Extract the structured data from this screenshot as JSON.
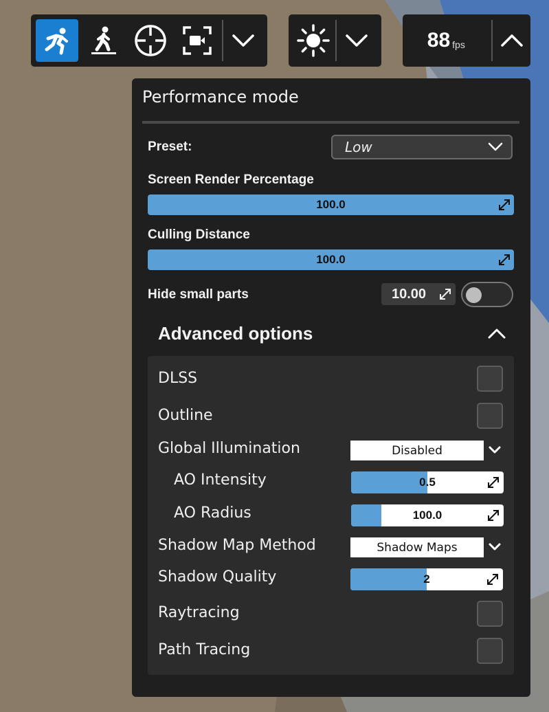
{
  "toolbar": {
    "modes": [
      {
        "icon": "run-icon",
        "active": true
      },
      {
        "icon": "walk-icon",
        "active": false
      },
      {
        "icon": "crosshair-icon",
        "active": false
      },
      {
        "icon": "camera-frame-icon",
        "active": false
      }
    ],
    "fps_value": "88",
    "fps_unit": "fps"
  },
  "panel": {
    "title": "Performance mode",
    "preset_label": "Preset:",
    "preset_value": "Low",
    "screen_render_label": "Screen Render Percentage",
    "screen_render_value": "100.0",
    "culling_label": "Culling Distance",
    "culling_value": "100.0",
    "hide_small_label": "Hide small parts",
    "hide_small_value": "10.00",
    "hide_small_enabled": false,
    "advanced_title": "Advanced options",
    "advanced": {
      "dlss_label": "DLSS",
      "dlss_checked": false,
      "outline_label": "Outline",
      "outline_checked": false,
      "gi_label": "Global Illumination",
      "gi_value": "Disabled",
      "ao_intensity_label": "AO Intensity",
      "ao_intensity_value": "0.5",
      "ao_intensity_fraction": 0.5,
      "ao_radius_label": "AO Radius",
      "ao_radius_value": "100.0",
      "ao_radius_fraction": 0.2,
      "shadow_method_label": "Shadow Map Method",
      "shadow_method_value": "Shadow Maps",
      "shadow_quality_label": "Shadow Quality",
      "shadow_quality_value": "2",
      "shadow_quality_fraction": 0.5,
      "raytracing_label": "Raytracing",
      "raytracing_checked": false,
      "pathtracing_label": "Path Tracing",
      "pathtracing_checked": false
    }
  },
  "colors": {
    "accent": "#1a7fd0",
    "slider_fill": "#5a9fd6",
    "panel_bg": "#1f1f1f",
    "background": "#8a7b66"
  }
}
